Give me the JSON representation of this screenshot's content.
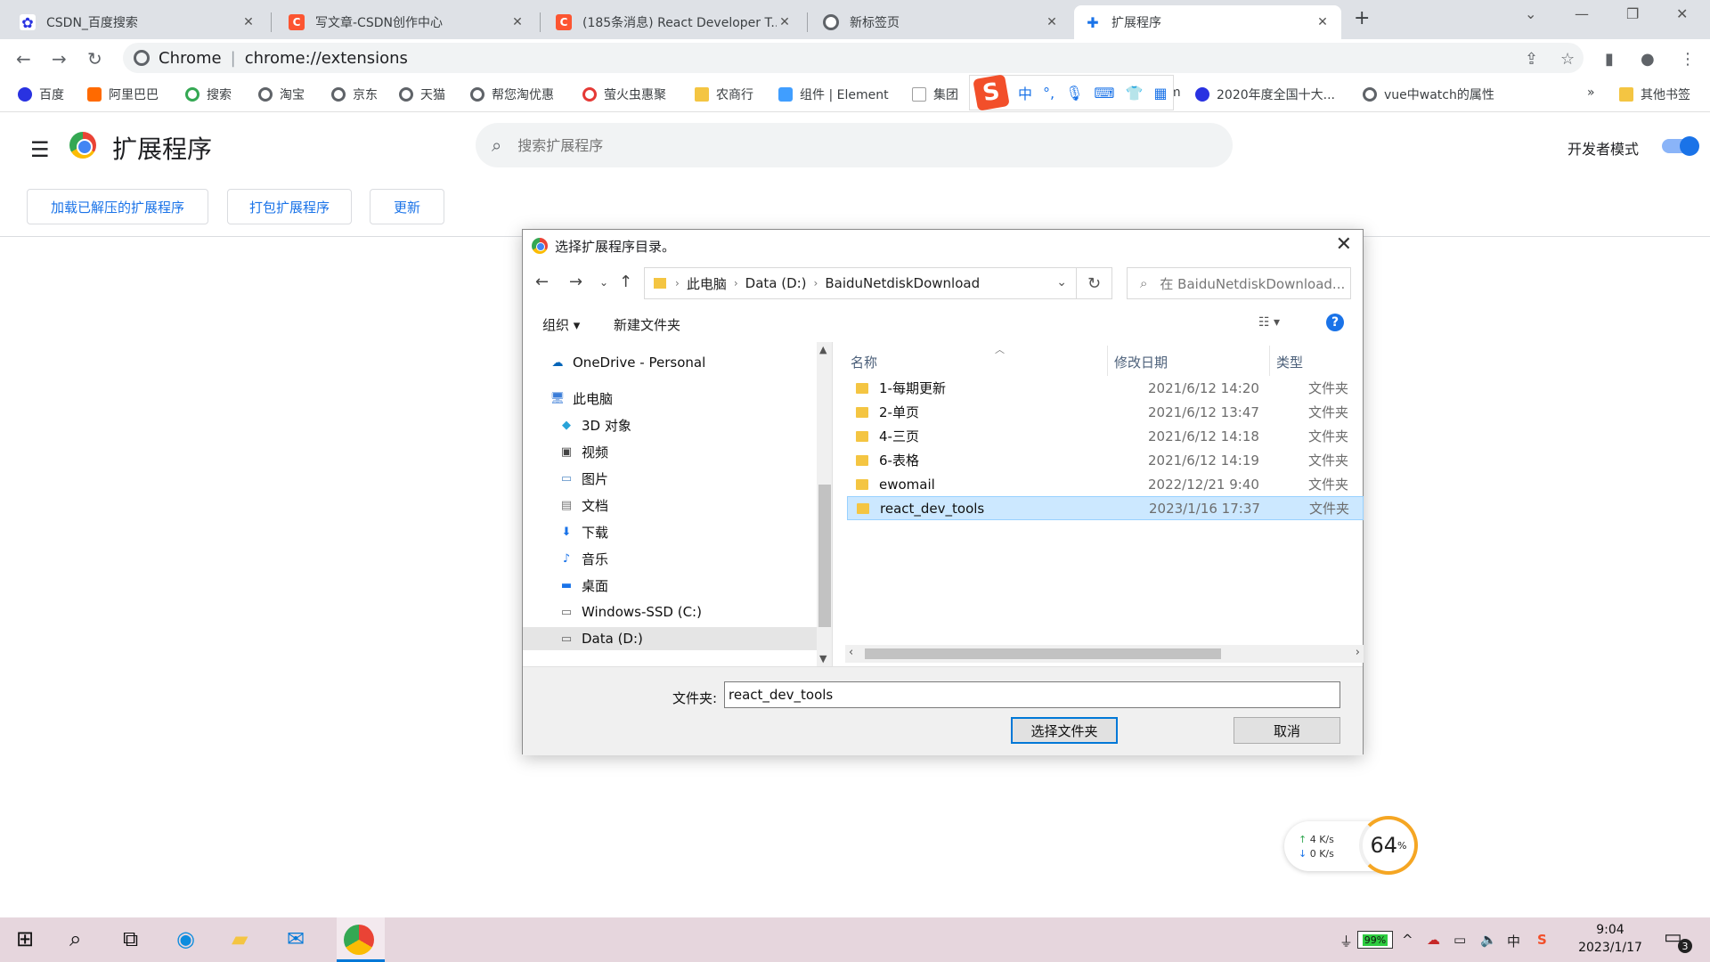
{
  "tabs": [
    {
      "title": "CSDN_百度搜索",
      "icon": "baidu-paw-icon",
      "color": "#2932e1"
    },
    {
      "title": "写文章-CSDN创作中心",
      "icon": "csdn-logo-icon",
      "color": "#fc5531"
    },
    {
      "title": "(185条消息) React Developer T...",
      "icon": "csdn-logo-icon",
      "color": "#fc5531"
    },
    {
      "title": "新标签页",
      "icon": "chrome-icon",
      "color": "#5f6368"
    },
    {
      "title": "扩展程序",
      "icon": "puzzle-icon",
      "color": "#1a73e8"
    }
  ],
  "omnibox": {
    "site": "Chrome",
    "url": "chrome://extensions"
  },
  "bookmarks": [
    {
      "label": "百度",
      "color": "#2932e1"
    },
    {
      "label": "阿里巴巴",
      "color": "#ff6a00"
    },
    {
      "label": "搜索",
      "color": "#34a853"
    },
    {
      "label": "淘宝",
      "color": "#5f6368"
    },
    {
      "label": "京东",
      "color": "#5f6368"
    },
    {
      "label": "天猫",
      "color": "#5f6368"
    },
    {
      "label": "帮您淘优惠",
      "color": "#5f6368"
    },
    {
      "label": "萤火虫惠聚",
      "color": "#e53935"
    },
    {
      "label": "农商行",
      "color": "#f4c542"
    },
    {
      "label": "组件 | Element",
      "color": "#409eff"
    },
    {
      "label": "集团",
      "color": "#9e9e9e"
    },
    {
      "label": "m",
      "color": "#ffffff"
    },
    {
      "label": "2020年度全国十大...",
      "color": "#2932e1"
    },
    {
      "label": "vue中watch的属性",
      "color": "#5f6368"
    },
    {
      "label": "»",
      "color": "#ffffff"
    },
    {
      "label": "其他书签",
      "color": "#f4c542"
    }
  ],
  "ime": {
    "logo": "S",
    "mode": "中",
    "punct": "°,"
  },
  "extensions": {
    "title": "扩展程序",
    "search_placeholder": "搜索扩展程序",
    "dev_mode_label": "开发者模式",
    "dev_mode_on": true,
    "buttons": [
      "加载已解压的扩展程序",
      "打包扩展程序",
      "更新"
    ]
  },
  "dialog": {
    "title": "选择扩展程序目录。",
    "path": [
      "此电脑",
      "Data (D:)",
      "BaiduNetdiskDownload"
    ],
    "search_placeholder": "在 BaiduNetdiskDownload...",
    "organize": "组织 ▾",
    "new_folder": "新建文件夹",
    "help": "?",
    "tree": [
      {
        "label": "OneDrive - Personal",
        "icon": "onedrive-icon"
      },
      {
        "label": "此电脑",
        "icon": "computer-icon"
      },
      {
        "label": "3D 对象",
        "icon": "cube-icon"
      },
      {
        "label": "视频",
        "icon": "video-icon"
      },
      {
        "label": "图片",
        "icon": "picture-icon"
      },
      {
        "label": "文档",
        "icon": "document-icon"
      },
      {
        "label": "下载",
        "icon": "download-icon"
      },
      {
        "label": "音乐",
        "icon": "music-icon"
      },
      {
        "label": "桌面",
        "icon": "desktop-icon"
      },
      {
        "label": "Windows-SSD (C:)",
        "icon": "drive-icon"
      },
      {
        "label": "Data (D:)",
        "icon": "drive-icon"
      }
    ],
    "columns": {
      "name": "名称",
      "date": "修改日期",
      "type": "类型"
    },
    "files": [
      {
        "name": "1-每期更新",
        "date": "2021/6/12 14:20",
        "type": "文件夹"
      },
      {
        "name": "2-单页",
        "date": "2021/6/12 13:47",
        "type": "文件夹"
      },
      {
        "name": "4-三页",
        "date": "2021/6/12 14:18",
        "type": "文件夹"
      },
      {
        "name": "6-表格",
        "date": "2021/6/12 14:19",
        "type": "文件夹"
      },
      {
        "name": "ewomail",
        "date": "2022/12/21 9:40",
        "type": "文件夹"
      },
      {
        "name": "react_dev_tools",
        "date": "2023/1/16 17:37",
        "type": "文件夹"
      }
    ],
    "selected_file": "react_dev_tools",
    "folder_label": "文件夹:",
    "folder_value": "react_dev_tools",
    "select_button": "选择文件夹",
    "cancel_button": "取消"
  },
  "net_widget": {
    "up": "4",
    "down": "0",
    "unit": "K/s",
    "percent": "64",
    "percent_unit": "%"
  },
  "taskbar": {
    "battery": "99%",
    "time": "9:04",
    "date": "2023/1/17",
    "notifications": "3"
  }
}
